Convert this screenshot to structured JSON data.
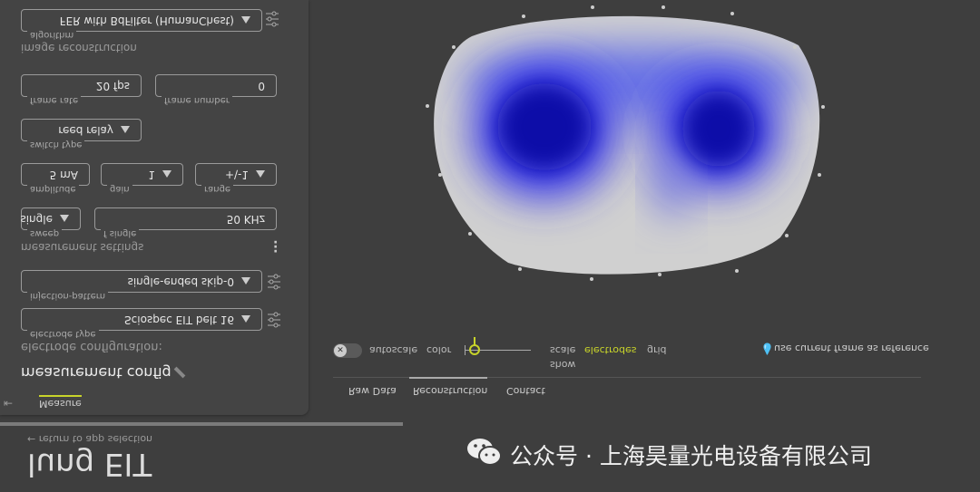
{
  "app": {
    "title": "lung EIT",
    "return_label": "return to app selection",
    "side_tab": "Measure"
  },
  "config": {
    "heading": "measurement config",
    "electrode_section": "electrode configuration:",
    "electrode_type": {
      "label": "electrode type",
      "value": "Sciospec EIT belt 16"
    },
    "injection_pattern": {
      "label": "injection-pattern",
      "value": "single-ended skip-0"
    },
    "measurement_section": "measurement settings",
    "sweep": {
      "label": "sweep",
      "value": "single"
    },
    "f_single": {
      "label": "f single",
      "value": "50 KHz"
    },
    "amplitude": {
      "label": "amplitude",
      "value": "5 mA"
    },
    "gain": {
      "label": "gain",
      "value": "1"
    },
    "range": {
      "label": "range",
      "value": "+\\-1"
    },
    "switch_type": {
      "label": "switch type",
      "value": "reed relay"
    },
    "frame_rate": {
      "label": "frame rate",
      "value": "20 fps"
    },
    "frame_number": {
      "label": "frame number",
      "value": "0"
    },
    "reconstruction_section": "image reconstruction",
    "algorithm": {
      "label": "algorithm",
      "value": "FER with BdFilter (HumanChest)"
    }
  },
  "toolbar": {
    "autoscale": "autoscale",
    "color": "color",
    "color_scale": 0.15,
    "scale": "scale",
    "show": "show",
    "electrodes": "electrodes",
    "grid": "grid",
    "reference": "use current frame as reference"
  },
  "tabs": [
    "Raw Data",
    "Reconstruction",
    "Contact"
  ],
  "watermark": "公众号 · 上海昊量光电设备有限公司",
  "colors": {
    "accent": "#c8d42a",
    "panel": "#444444",
    "background": "#3e3e3e"
  }
}
